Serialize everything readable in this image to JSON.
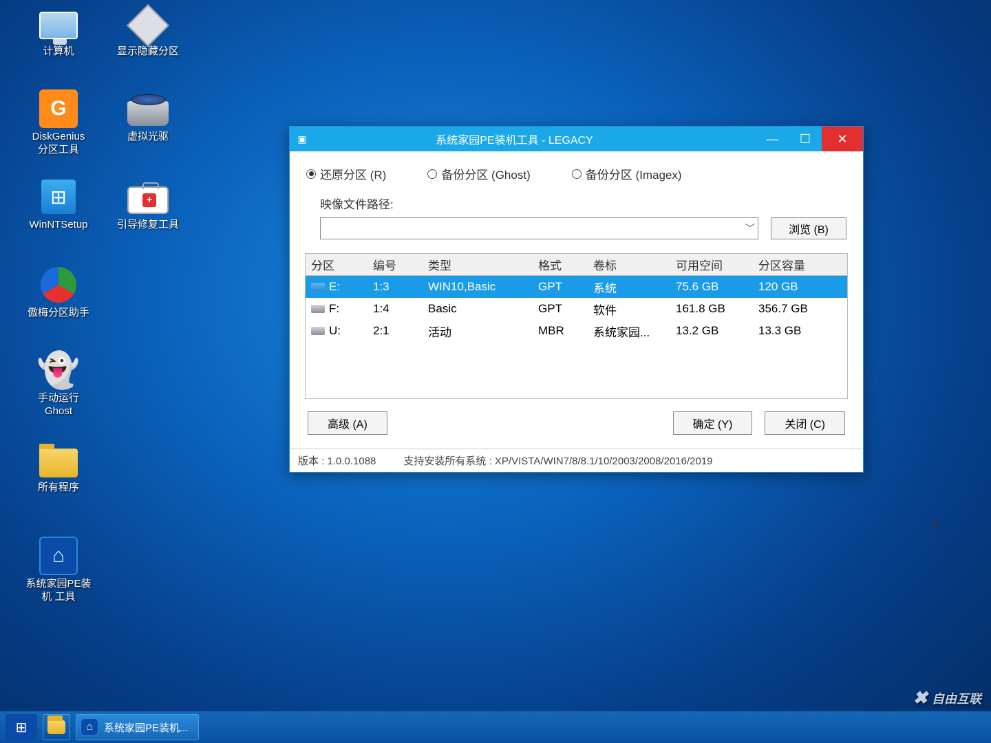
{
  "desktop": {
    "icons": [
      {
        "label": "计算机",
        "icon": "monitor"
      },
      {
        "label": "显示隐藏分区",
        "icon": "diamond"
      },
      {
        "label": "DiskGenius\n分区工具",
        "icon": "dg"
      },
      {
        "label": "虚拟光驱",
        "icon": "drive"
      },
      {
        "label": "WinNTSetup",
        "icon": "winnt"
      },
      {
        "label": "引导修复工具",
        "icon": "toolbox"
      },
      {
        "label": "傲梅分区助手",
        "icon": "aomei"
      },
      {
        "label": "手动运行\nGhost",
        "icon": "ghost"
      },
      {
        "label": "所有程序",
        "icon": "folder"
      },
      {
        "label": "系统家园PE装\n机 工具",
        "icon": "house"
      }
    ]
  },
  "taskbar": {
    "app_label": "系统家园PE装机..."
  },
  "watermark": "自由互联",
  "dialog": {
    "title": "系统家园PE装机工具 - LEGACY",
    "radios": {
      "restore": "还原分区 (R)",
      "backup_ghost": "备份分区 (Ghost)",
      "backup_imagex": "备份分区 (Imagex)"
    },
    "path_label": "映像文件路径:",
    "browse": "浏览 (B)",
    "table": {
      "headers": {
        "c0": "分区",
        "c1": "编号",
        "c2": "类型",
        "c3": "格式",
        "c4": "卷标",
        "c5": "可用空间",
        "c6": "分区容量"
      },
      "rows": [
        {
          "drive": "E:",
          "num": "1:3",
          "type": "WIN10,Basic",
          "fmt": "GPT",
          "label": "系统",
          "free": "75.6 GB",
          "cap": "120 GB",
          "sel": true,
          "iconCls": "di"
        },
        {
          "drive": "F:",
          "num": "1:4",
          "type": "Basic",
          "fmt": "GPT",
          "label": "软件",
          "free": "161.8 GB",
          "cap": "356.7 GB",
          "sel": false,
          "iconCls": "di gray"
        },
        {
          "drive": "U:",
          "num": "2:1",
          "type": "活动",
          "fmt": "MBR",
          "label": "系统家园...",
          "free": "13.2 GB",
          "cap": "13.3 GB",
          "sel": false,
          "iconCls": "di gray"
        }
      ]
    },
    "buttons": {
      "advanced": "高级 (A)",
      "ok": "确定 (Y)",
      "close": "关闭 (C)"
    },
    "status": {
      "version": "版本 : 1.0.0.1088",
      "support": "支持安装所有系统 : XP/VISTA/WIN7/8/8.1/10/2003/2008/2016/2019"
    }
  }
}
